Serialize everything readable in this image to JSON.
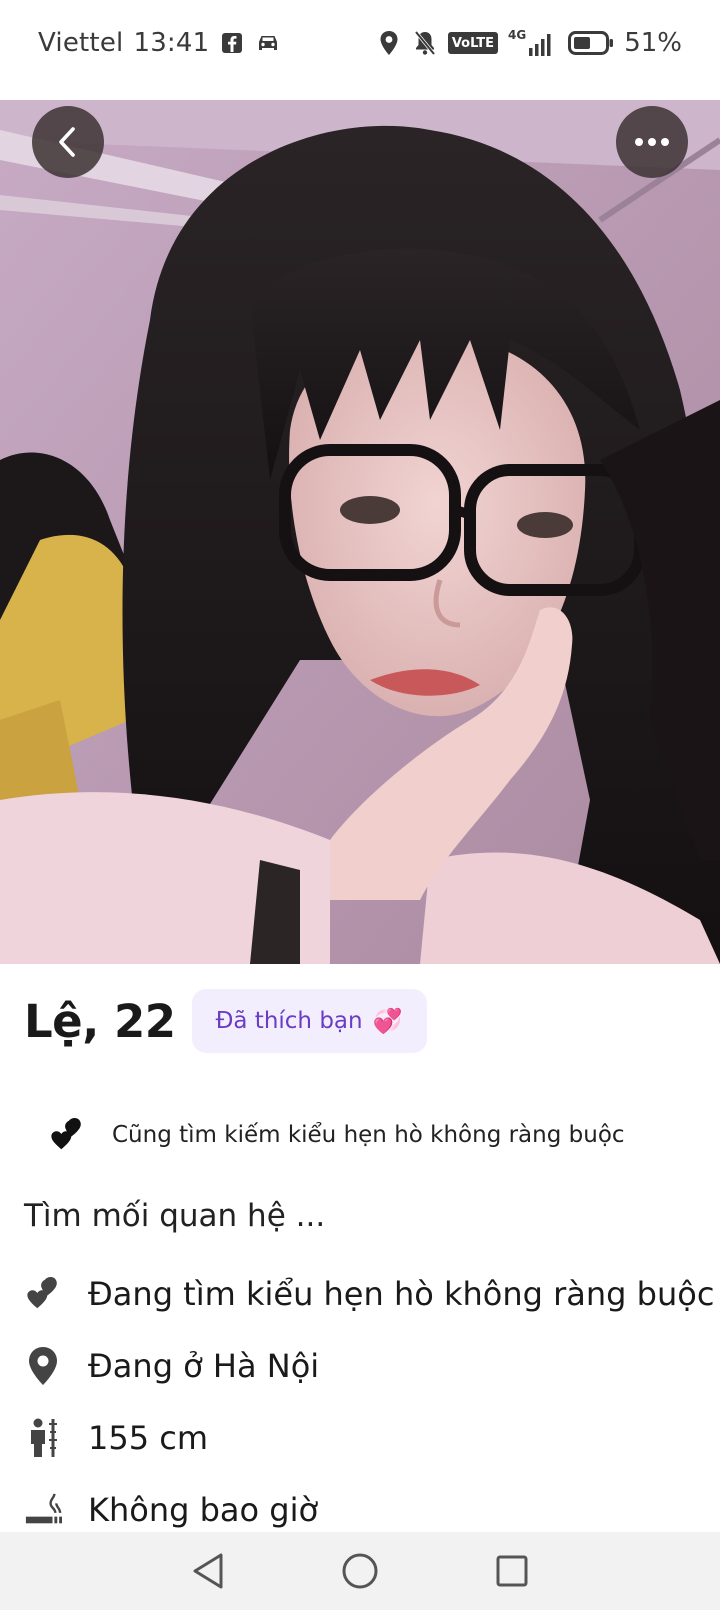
{
  "status_bar": {
    "carrier": "Viettel",
    "time": "13:41",
    "network": "4G",
    "volte": "VoLTE",
    "battery": "51%",
    "icons": [
      "facebook-icon",
      "car-icon",
      "location-icon",
      "mute-icon",
      "volte-icon",
      "signal-icon",
      "battery-icon"
    ]
  },
  "profile": {
    "name_age": "Lệ, 22",
    "liked_badge": "Đã thích bạn",
    "liked_emoji": "💞",
    "common_tag": "Cũng tìm kiếm kiểu hẹn hò không ràng buộc",
    "section_title": "Tìm mối quan hệ ...",
    "details": [
      {
        "icon": "hearts-icon",
        "text": "Đang tìm kiểu hẹn hò không ràng buộc"
      },
      {
        "icon": "location-pin-icon",
        "text": "Đang ở Hà Nội"
      },
      {
        "icon": "height-icon",
        "text": "155 cm"
      },
      {
        "icon": "smoking-icon",
        "text": "Không bao giờ"
      }
    ]
  },
  "colors": {
    "badge_bg": "#f3eefe",
    "badge_text": "#6a3dc6",
    "photo_wall": "#b79ab3"
  }
}
